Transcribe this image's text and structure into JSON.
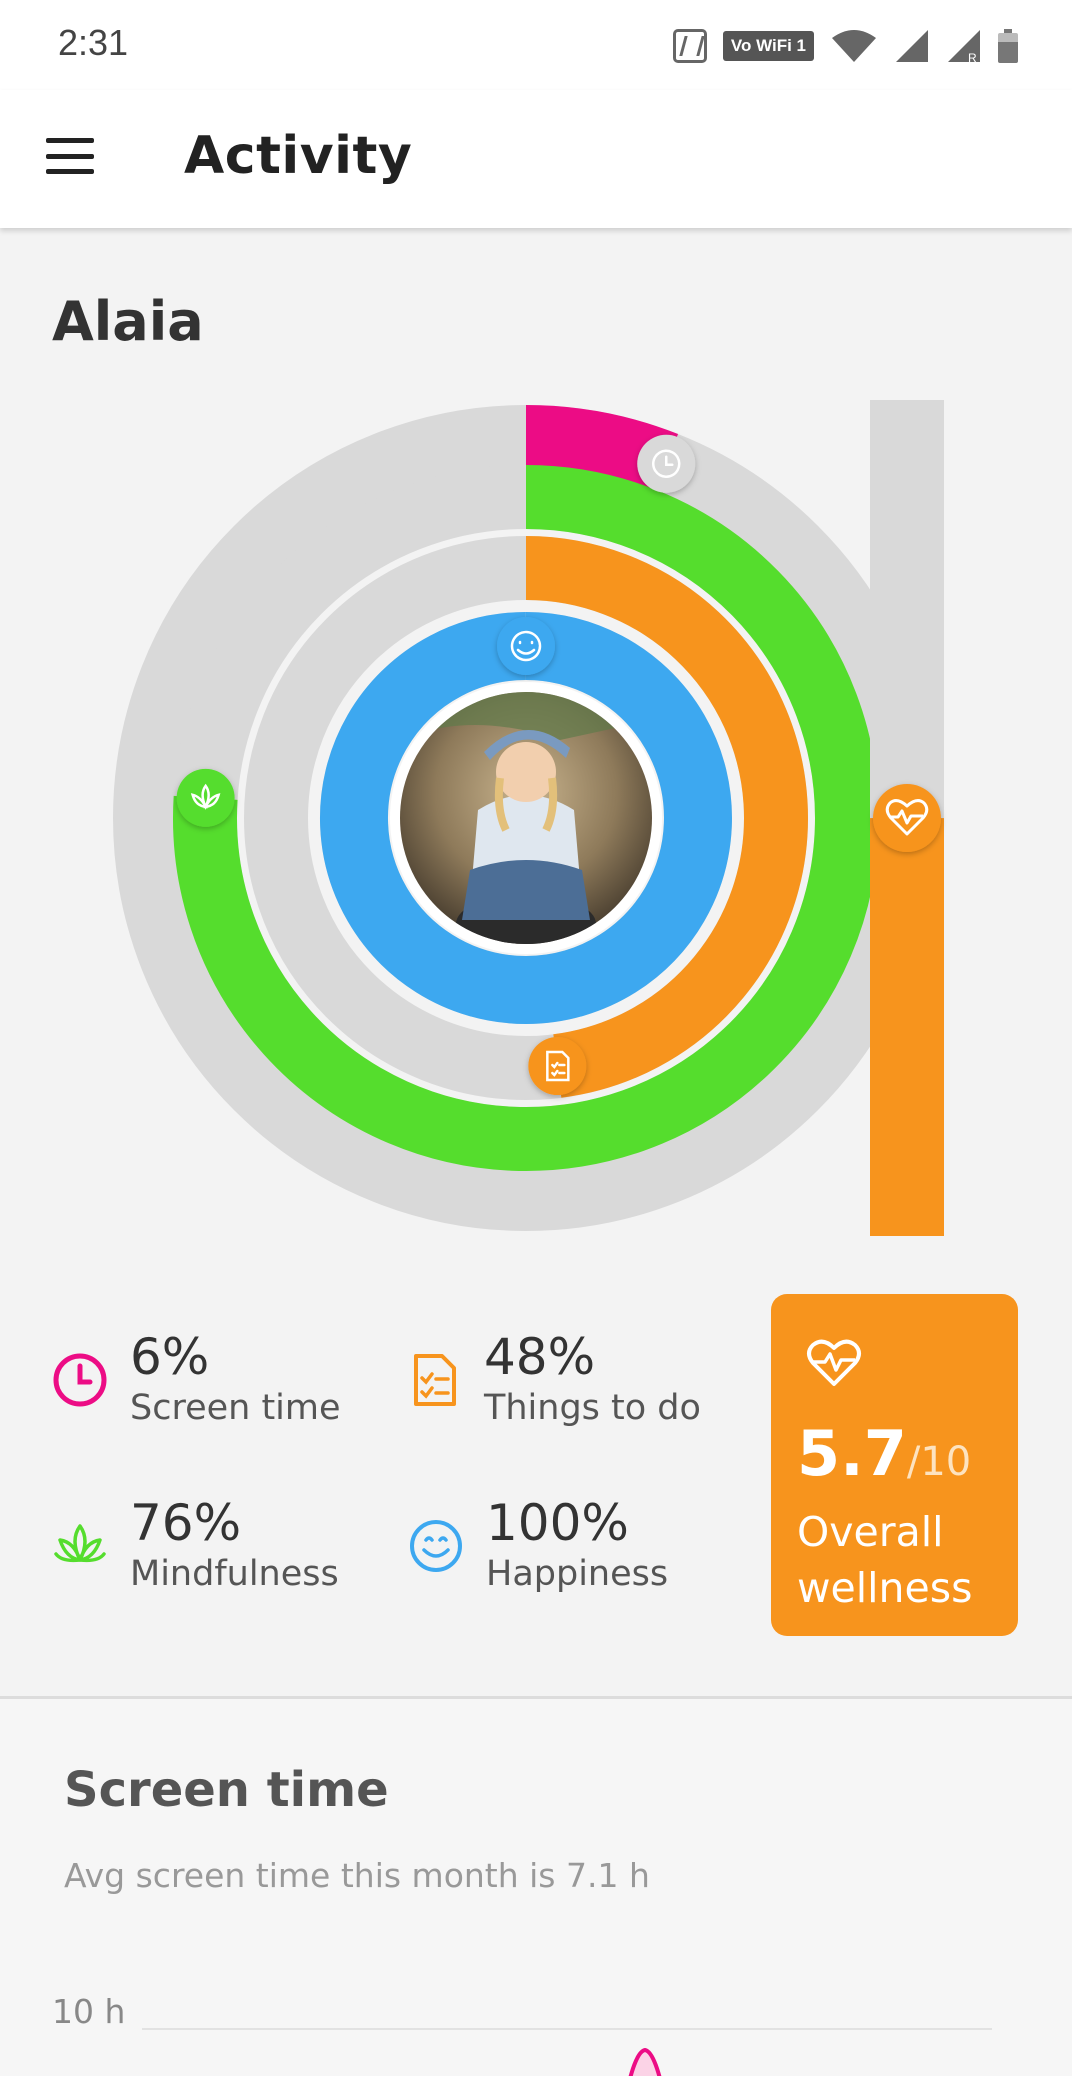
{
  "status_bar": {
    "time": "2:31",
    "wifi_badge": "Vo WiFi 1"
  },
  "app_bar": {
    "title": "Activity",
    "menu_icon": "menu-icon"
  },
  "profile": {
    "name": "Alaia"
  },
  "colors": {
    "screen_time": "#ec0c85",
    "things_to_do": "#f7941d",
    "mindfulness": "#55dd2d",
    "happiness": "#3da8f0",
    "ring_track": "#d9d9d9"
  },
  "chart_data": {
    "type": "radial-bar",
    "series": [
      {
        "name": "Screen time",
        "value": 6,
        "unit": "%"
      },
      {
        "name": "Mindfulness",
        "value": 76,
        "unit": "%"
      },
      {
        "name": "Things to do",
        "value": 48,
        "unit": "%"
      },
      {
        "name": "Happiness",
        "value": 100,
        "unit": "%"
      }
    ],
    "overall_wellness": {
      "value": 5.7,
      "max": 10
    }
  },
  "stats": [
    {
      "value": "6%",
      "label": "Screen time",
      "icon": "clock-icon"
    },
    {
      "value": "48%",
      "label": "Things to do",
      "icon": "checklist-icon"
    },
    {
      "value": "76%",
      "label": "Mindfulness",
      "icon": "lotus-icon"
    },
    {
      "value": "100%",
      "label": "Happiness",
      "icon": "smiley-icon"
    }
  ],
  "wellness": {
    "score": "5.7",
    "denominator": "/10",
    "label_line1": "Overall",
    "label_line2": "wellness",
    "icon": "heart-pulse-icon"
  },
  "screen_time": {
    "title": "Screen time",
    "subtitle": "Avg screen time this month is 7.1 h",
    "y_axis_label": "10 h"
  }
}
